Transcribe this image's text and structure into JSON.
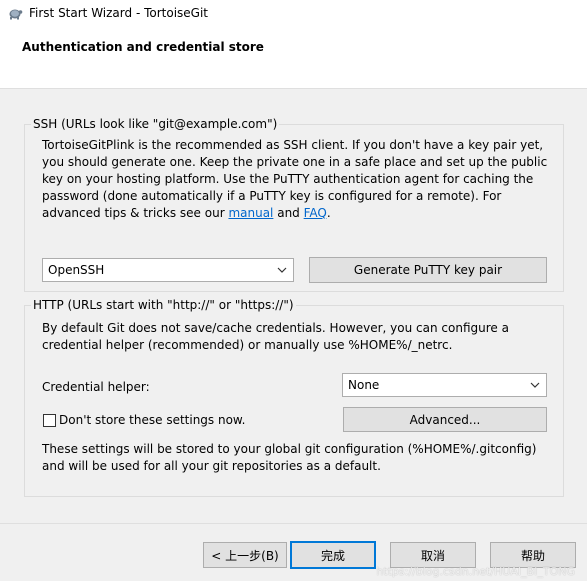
{
  "window": {
    "title": "First Start Wizard - TortoiseGit"
  },
  "header": {
    "title": "Authentication and credential store"
  },
  "ssh": {
    "group_label": "SSH (URLs look like \"git@example.com\")",
    "line1": "TortoiseGitPlink is the recommended as SSH client. If you don't have a key pair yet,",
    "line2": "you should generate one. Keep the private one in a safe place and set up the public",
    "line3": "key on your hosting platform. Use the PuTTY authentication agent for caching the",
    "line4": "password (done automatically if a PuTTY key is configured for a remote). For",
    "line5_prefix": "advanced tips & tricks see our ",
    "link_manual": "manual",
    "line5_and": " and ",
    "link_faq": "FAQ",
    "line5_end": ".",
    "client_select": "OpenSSH",
    "generate_button": "Generate PuTTY  key pair"
  },
  "http": {
    "group_label": "HTTP (URLs start with \"http://\" or \"https://\")",
    "line1": "By default Git does not save/cache credentials. However, you can configure a",
    "line2": "credential helper (recommended) or manually use %HOME%/_netrc.",
    "helper_label": "Credential helper:",
    "helper_select": "None",
    "dont_store_label": "Don't store these settings now.",
    "dont_store_checked": false,
    "advanced_button": "Advanced...",
    "note1": "These settings will be stored to your global git configuration (%HOME%/.gitconfig)",
    "note2": "and will be used for all your git repositories as a default."
  },
  "footer": {
    "back_button": "< 上一步(B)",
    "finish_button": "完成",
    "cancel_button": "取消",
    "help_button": "帮助"
  },
  "watermark": "https://blog.csdn.net/HUAI_BI_TONG",
  "colors": {
    "link": "#0066cc",
    "focus_border": "#0078d7",
    "button_bg": "#e1e1e1"
  }
}
